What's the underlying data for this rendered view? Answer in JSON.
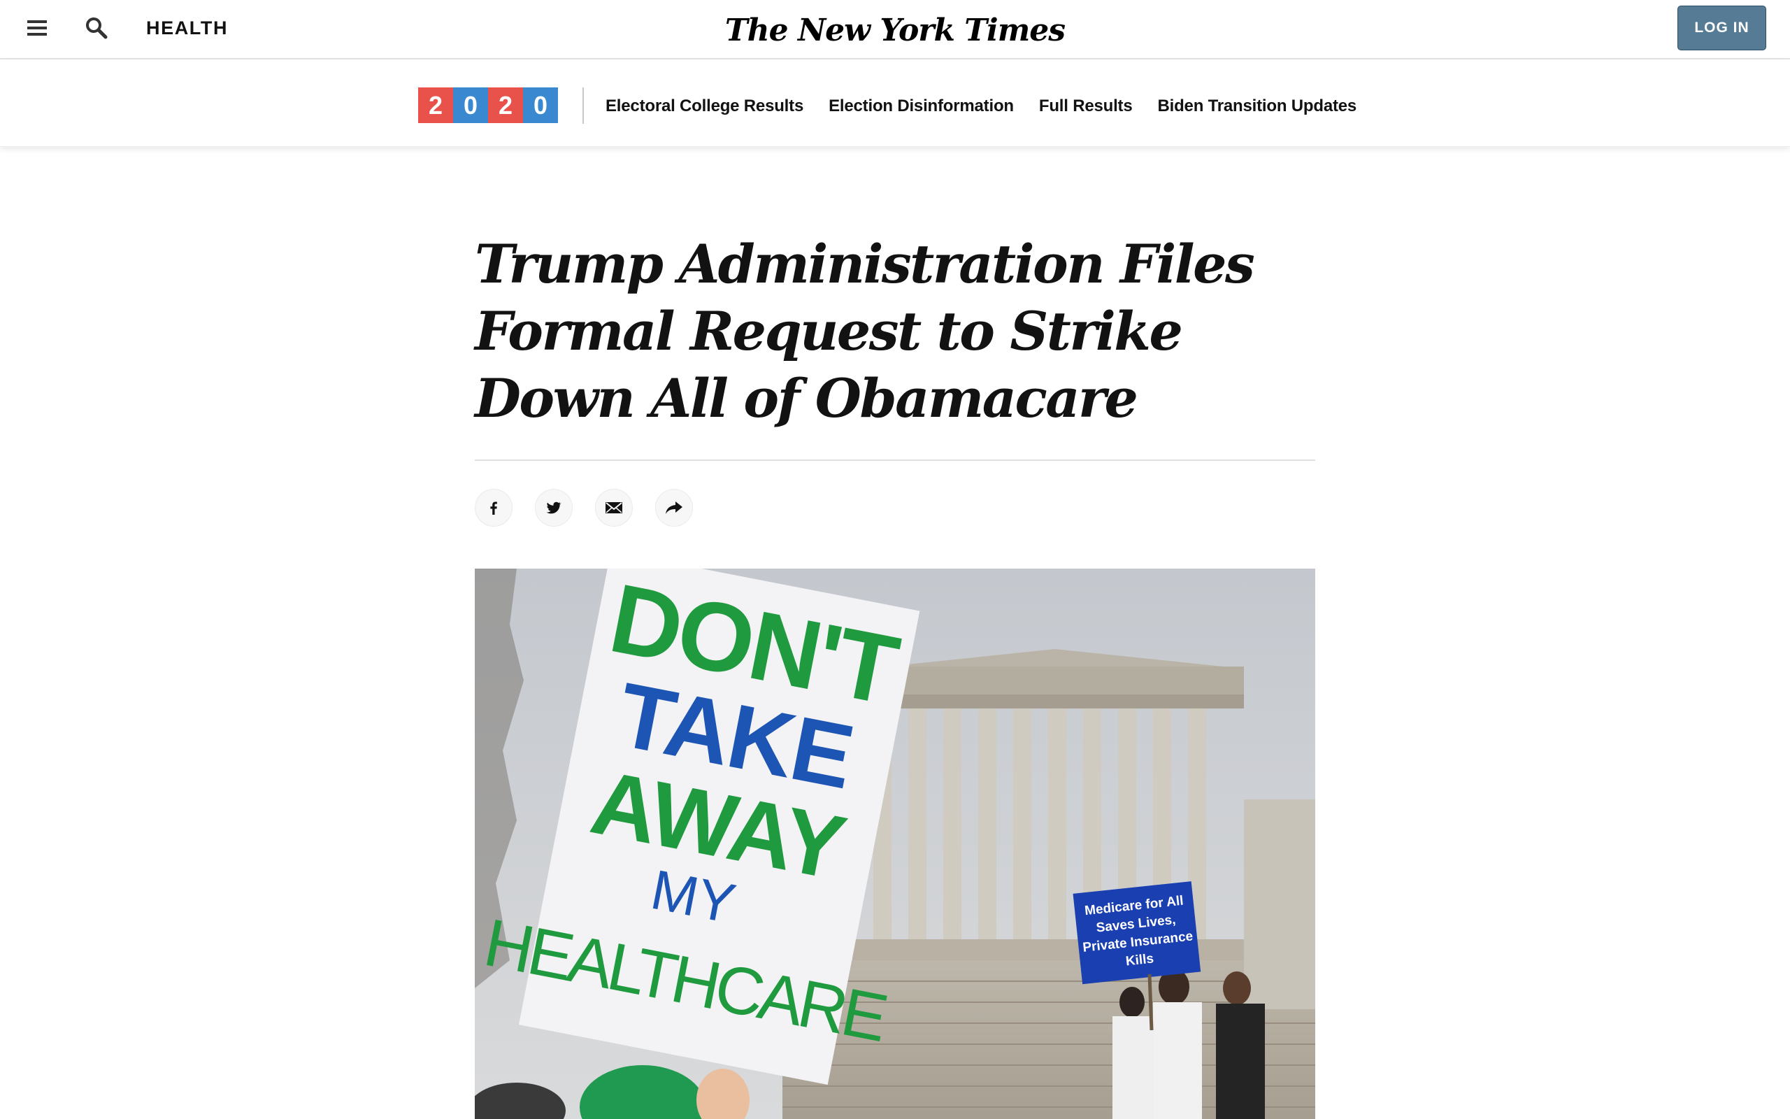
{
  "header": {
    "section": "HEALTH",
    "logo": "The New York Times",
    "login_label": "LOG IN"
  },
  "election_nav": {
    "year_digits": [
      {
        "digit": "2",
        "color": "#e8524a"
      },
      {
        "digit": "0",
        "color": "#3a88d0"
      },
      {
        "digit": "2",
        "color": "#e8524a"
      },
      {
        "digit": "0",
        "color": "#3a88d0"
      }
    ],
    "links": [
      "Electoral College Results",
      "Election Disinformation",
      "Full Results",
      "Biden Transition Updates"
    ]
  },
  "article": {
    "headline": "Trump Administration Files Formal Request to Strike Down All of Obamacare"
  },
  "share": {
    "icons": [
      "facebook-icon",
      "twitter-icon",
      "email-icon",
      "share-icon"
    ]
  },
  "lead_image": {
    "sign_lines": [
      "DON'T",
      "TAKE",
      "AWAY",
      "MY",
      "HEALTHCARE"
    ],
    "placard_lines": [
      "Medicare for All",
      "Saves Lives,",
      "Private Insurance",
      "Kills"
    ]
  },
  "colors": {
    "login_bg": "#567b95",
    "sign_green": "#1f9a3e",
    "sign_blue": "#1d55b5",
    "placard_blue": "#1a3fb0"
  }
}
